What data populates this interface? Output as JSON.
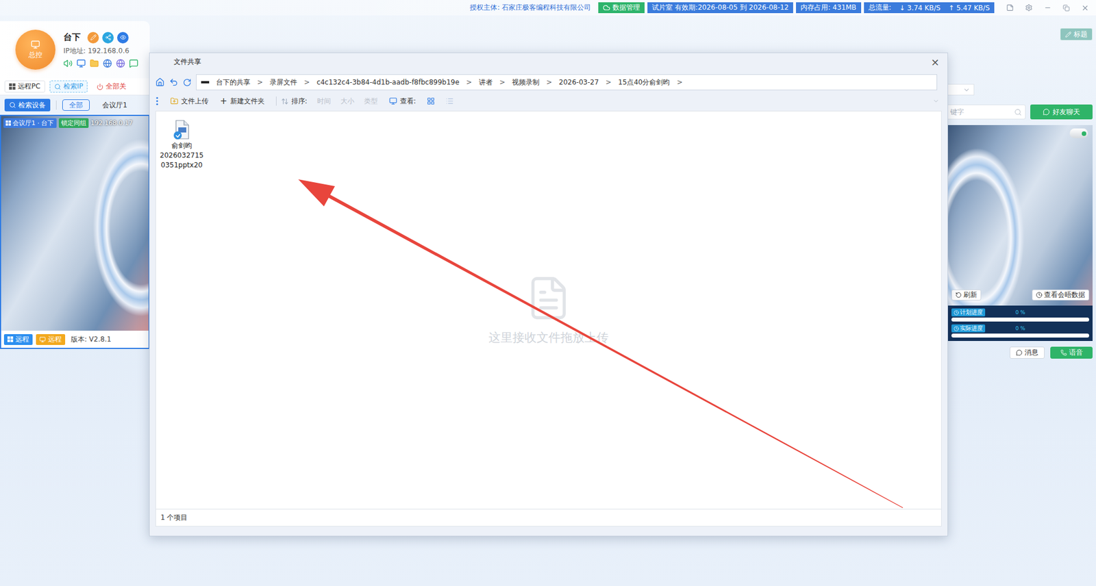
{
  "top_bar": {
    "license": "授权主体: 石家庄极客编程科技有限公司",
    "badges": [
      {
        "text": "数据管理",
        "kind": "cloud",
        "color": "#2db46b"
      },
      {
        "text": "试片室 有效期:2026-08-05 到 2026-08-12",
        "kind": "plain",
        "color": "#3a7bdc"
      },
      {
        "text": "内存占用: 431MB",
        "kind": "plain",
        "color": "#3a7bdc"
      }
    ],
    "traffic": {
      "label": "总流量:",
      "down": "↓ 3.74 KB/S",
      "up": "↑ 5.47 KB/S",
      "color": "#3a7bdc"
    }
  },
  "profile": {
    "logo": "总控",
    "name": "台下",
    "ip": "IP地址: 192.168.0.6"
  },
  "tool_buttons": [
    {
      "label": "远程PC",
      "kind": "windows"
    },
    {
      "label": "检索IP",
      "kind": "dashed"
    },
    {
      "label": "全部关",
      "kind": "power"
    }
  ],
  "filter": {
    "search_button": "检索设备",
    "tabs": [
      {
        "label": "全部",
        "selected": true
      },
      {
        "label": "会议厅1",
        "selected": false
      }
    ]
  },
  "device_card": {
    "tags": [
      {
        "text": "会议厅1 · 台下",
        "color": "#3d7be0"
      },
      {
        "text": "锁定同组",
        "color": "#2fa85c"
      }
    ],
    "ip": "192.168.0.17",
    "buttons": [
      {
        "label": "远程",
        "kind": "windows",
        "color": "#2d8ff0"
      },
      {
        "label": "远程",
        "kind": "monitor",
        "color": "#f2a91e"
      }
    ],
    "version": "版本: V2.8.1"
  },
  "right_panel": {
    "title_button": "标题",
    "search": {
      "placeholder": "键字"
    },
    "chat_button": "好友聊天",
    "online": true,
    "refresh": "刷新",
    "meeting_data": "查看会晤数据",
    "progress": [
      {
        "label": "计划进度",
        "level": 0,
        "reading": "0 %"
      },
      {
        "label": "实际进度",
        "level": 0,
        "reading": "0 %"
      }
    ],
    "message": "消息",
    "voice": "语音"
  },
  "dialog": {
    "title": "文件共享",
    "close": "×",
    "breadcrumb": [
      "台下的共享",
      "录屏文件",
      "c4c132c4-3b84-4d1b-aadb-f8fbc899b19e",
      "讲者",
      "视频录制",
      "2026-03-27",
      "15点40分俞剑昀"
    ],
    "separator": ">",
    "toolbar": {
      "upload": "文件上传",
      "new_folder_icon": "+",
      "new_folder": "新建文件夹",
      "sort_label": "排序:",
      "sort_options": [
        {
          "label": "时间",
          "disabled": true
        },
        {
          "label": "大小",
          "disabled": true
        },
        {
          "label": "类型",
          "disabled": true
        }
      ],
      "view_label": "查看:",
      "views": [
        {
          "kind": "grid",
          "selected": true
        },
        {
          "kind": "list",
          "selected": false
        }
      ]
    },
    "files": [
      {
        "name_lines": [
          "俞剑昀",
          "2026032715",
          "0351pptx20"
        ],
        "selected": false
      }
    ],
    "drop_hint": "这里接收文件拖放上传",
    "status": "1 个项目"
  }
}
